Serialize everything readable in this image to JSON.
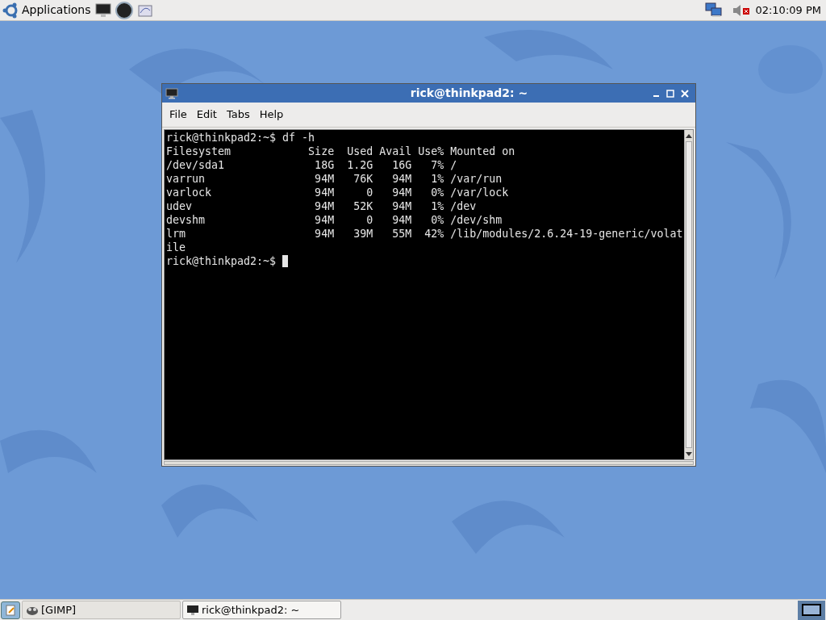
{
  "top_panel": {
    "menu": "Applications",
    "clock": "02:10:09 PM"
  },
  "window": {
    "title": "rick@thinkpad2: ~",
    "menu": [
      "File",
      "Edit",
      "Tabs",
      "Help"
    ],
    "terminal": {
      "lines": [
        "rick@thinkpad2:~$ df -h",
        "Filesystem            Size  Used Avail Use% Mounted on",
        "/dev/sda1              18G  1.2G   16G   7% /",
        "varrun                 94M   76K   94M   1% /var/run",
        "varlock                94M     0   94M   0% /var/lock",
        "udev                   94M   52K   94M   1% /dev",
        "devshm                 94M     0   94M   0% /dev/shm",
        "lrm                    94M   39M   55M  42% /lib/modules/2.6.24-19-generic/volat",
        "ile",
        "rick@thinkpad2:~$ "
      ],
      "cursor": true
    }
  },
  "taskbar": {
    "tasks": [
      {
        "label": "[GIMP]",
        "selected": false
      },
      {
        "label": "rick@thinkpad2: ~",
        "selected": true
      }
    ]
  }
}
